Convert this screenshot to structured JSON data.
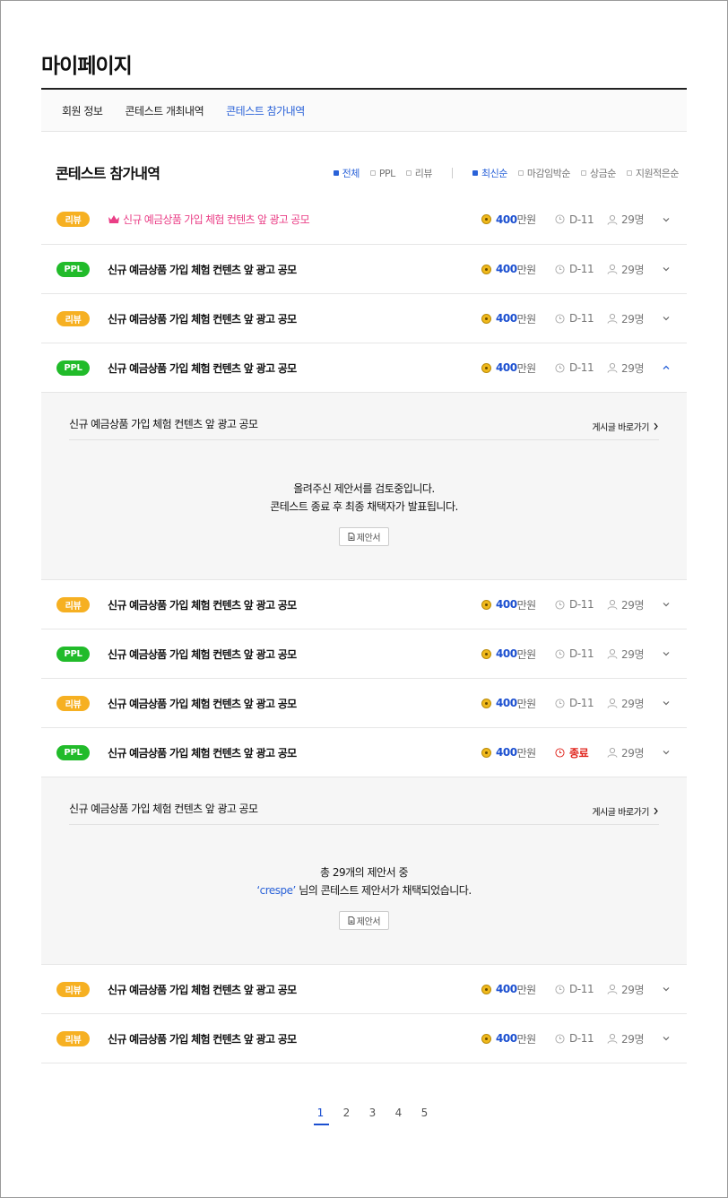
{
  "page": {
    "title": "마이페이지"
  },
  "tabs": [
    {
      "label": "회원 정보",
      "active": false
    },
    {
      "label": "콘테스트 개최내역",
      "active": false
    },
    {
      "label": "콘테스트 참가내역",
      "active": true
    }
  ],
  "section": {
    "title": "콘테스트 참가내역"
  },
  "filters": {
    "type": [
      {
        "label": "전체",
        "checked": true
      },
      {
        "label": "PPL",
        "checked": false
      },
      {
        "label": "리뷰",
        "checked": false
      }
    ],
    "sort": [
      {
        "label": "최신순",
        "checked": true
      },
      {
        "label": "마감임박순",
        "checked": false
      },
      {
        "label": "상금순",
        "checked": false
      },
      {
        "label": "지원적은순",
        "checked": false
      }
    ]
  },
  "rows": [
    {
      "badge": "리뷰",
      "title": "신규 예금상품 가입 체험 컨텐츠 앞 광고 공모",
      "prize": "400",
      "prize_unit": "만원",
      "dday": "D-11",
      "people": "29명"
    },
    {
      "badge": "PPL",
      "title": "신규 예금상품 가입 체험 컨텐츠 앞 광고 공모",
      "prize": "400",
      "prize_unit": "만원",
      "dday": "D-11",
      "people": "29명"
    },
    {
      "badge": "리뷰",
      "title": "신규 예금상품 가입 체험 컨텐츠 앞 광고 공모",
      "prize": "400",
      "prize_unit": "만원",
      "dday": "D-11",
      "people": "29명"
    },
    {
      "badge": "PPL",
      "title": "신규 예금상품 가입 체험 컨텐츠 앞 광고 공모",
      "prize": "400",
      "prize_unit": "만원",
      "dday": "D-11",
      "people": "29명"
    },
    {
      "badge": "리뷰",
      "title": "신규 예금상품 가입 체험 컨텐츠 앞 광고 공모",
      "prize": "400",
      "prize_unit": "만원",
      "dday": "D-11",
      "people": "29명"
    },
    {
      "badge": "PPL",
      "title": "신규 예금상품 가입 체험 컨텐츠 앞 광고 공모",
      "prize": "400",
      "prize_unit": "만원",
      "dday": "D-11",
      "people": "29명"
    },
    {
      "badge": "리뷰",
      "title": "신규 예금상품 가입 체험 컨텐츠 앞 광고 공모",
      "prize": "400",
      "prize_unit": "만원",
      "dday": "D-11",
      "people": "29명"
    },
    {
      "badge": "PPL",
      "title": "신규 예금상품 가입 체험 컨텐츠 앞 광고 공모",
      "prize": "400",
      "prize_unit": "만원",
      "dday": "종료",
      "people": "29명"
    },
    {
      "badge": "리뷰",
      "title": "신규 예금상품 가입 체험 컨텐츠 앞 광고 공모",
      "prize": "400",
      "prize_unit": "만원",
      "dday": "D-11",
      "people": "29명"
    },
    {
      "badge": "리뷰",
      "title": "신규 예금상품 가입 체험 컨텐츠 앞 광고 공모",
      "prize": "400",
      "prize_unit": "만원",
      "dday": "D-11",
      "people": "29명"
    }
  ],
  "detail1": {
    "title": "신규 예금상품 가입 체험 컨텐츠 앞 광고 공모",
    "link": "게시글 바로가기",
    "line1": "올려주신 제안서를 검토중입니다.",
    "line2": "콘테스트 종료 후 최종 채택자가 발표됩니다.",
    "button": "제안서"
  },
  "detail2": {
    "title": "신규 예금상품 가입 체험 컨텐츠 앞 광고 공모",
    "link": "게시글 바로가기",
    "line1": "총 29개의 제안서 중",
    "user": "‘crespe’",
    "line2_rest": " 님의 콘테스트 제안서가 채택되었습니다.",
    "button": "제안서"
  },
  "pagination": {
    "pages": [
      "1",
      "2",
      "3",
      "4",
      "5"
    ],
    "current": "1"
  },
  "colors": {
    "accent": "#2a62d8",
    "review": "#f6b022",
    "ppl": "#21bb2a",
    "hot": "#ea3e86",
    "ended": "#e0231b"
  }
}
